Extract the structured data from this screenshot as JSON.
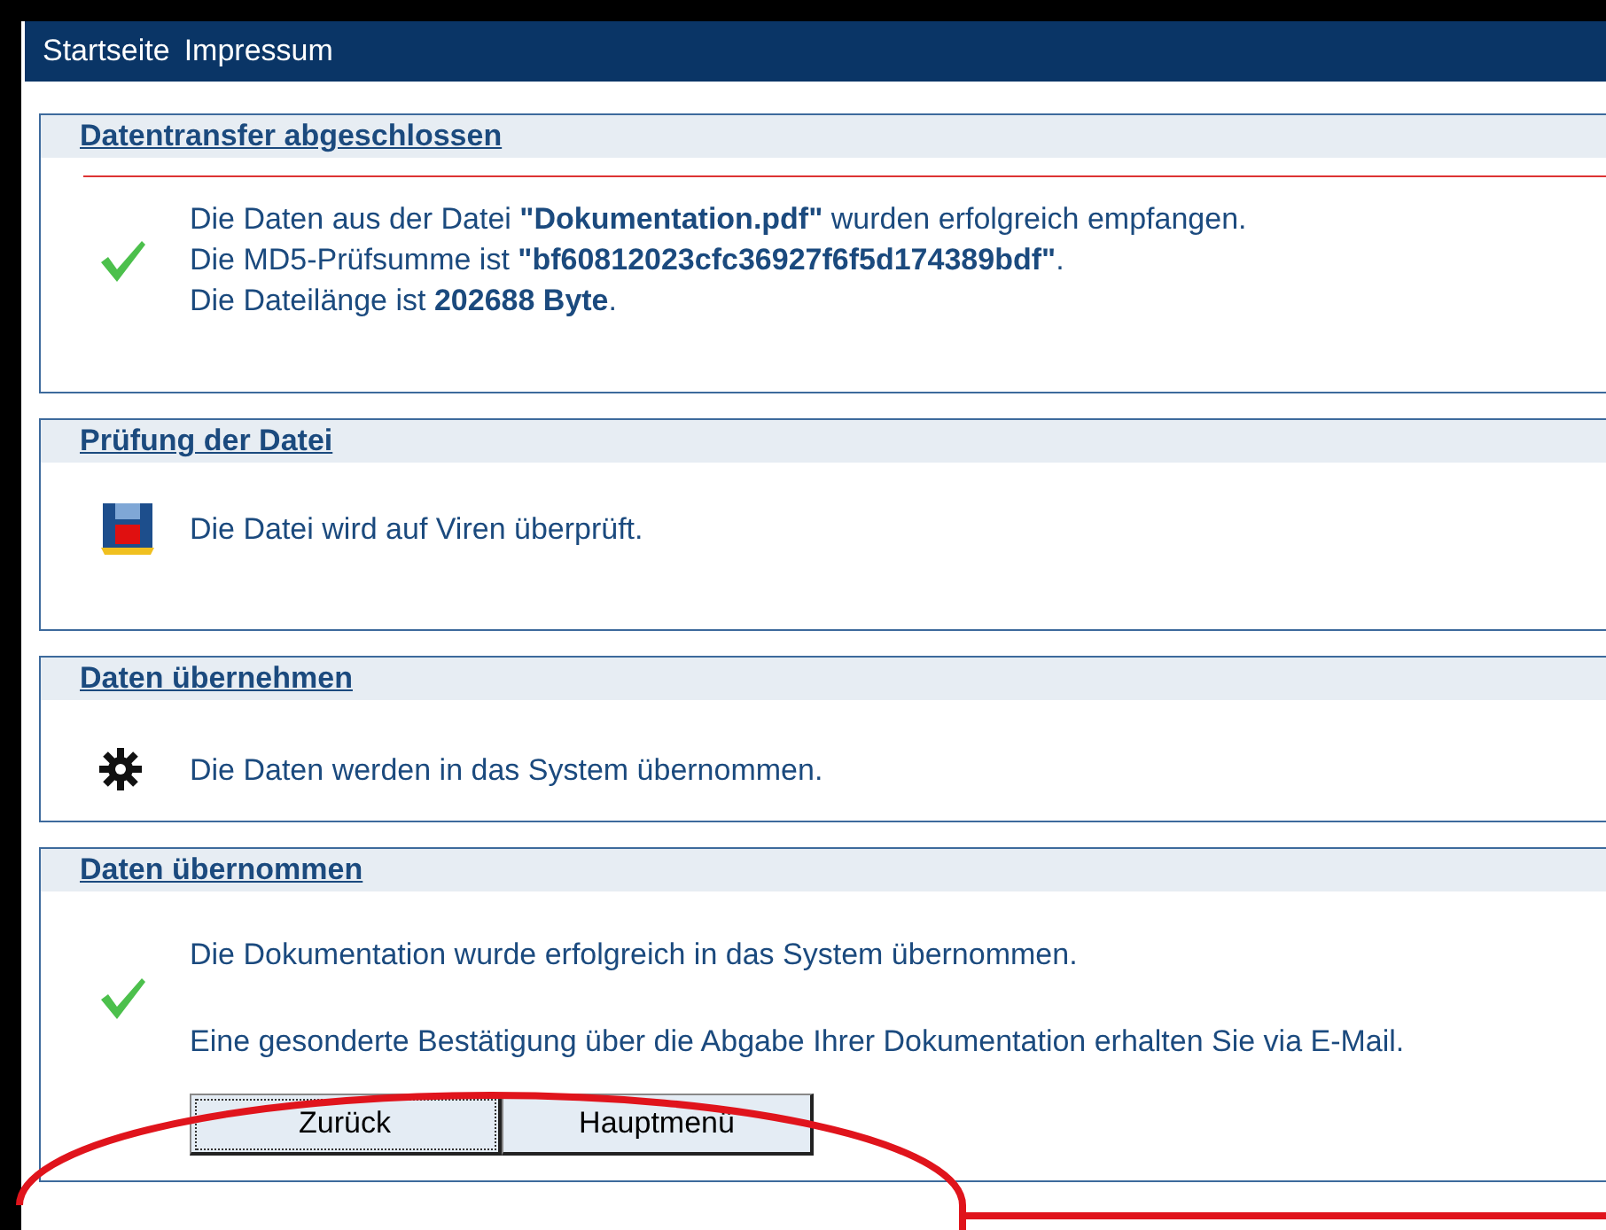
{
  "nav": [
    {
      "label": "Startseite"
    },
    {
      "label": "Impressum"
    }
  ],
  "sections": [
    {
      "title": "Datentransfer abgeschlossen",
      "divider": true,
      "kind": "done",
      "lines": [
        "Die Daten aus der Datei **\"Dokumentation.pdf\"** wurden erfolgreich empfangen.",
        "Die MD5-Prüfsumme ist **\"bf60812023cfc36927f6f5d174389bdf\"**.",
        "Die Dateilänge ist **202688 Byte**."
      ]
    },
    {
      "title": "Prüfung der Datei",
      "divider": false,
      "kind": "scan",
      "lines": [
        "Die Datei wird auf Viren überprüft."
      ]
    },
    {
      "title": "Daten übernehmen",
      "divider": false,
      "kind": "process",
      "lines": [
        "Die Daten werden in das System übernommen."
      ]
    },
    {
      "title": "Daten übernommen",
      "divider": false,
      "kind": "done",
      "lines": [
        "Die Dokumentation wurde erfolgreich in das System übernommen.",
        "Eine gesonderte Bestätigung über die Abgabe Ihrer Dokumentation erhalten Sie via E-Mail."
      ],
      "buttons": [
        {
          "label": "Zurück",
          "focused": true
        },
        {
          "label": "Hauptmenü",
          "focused": false
        }
      ]
    }
  ]
}
